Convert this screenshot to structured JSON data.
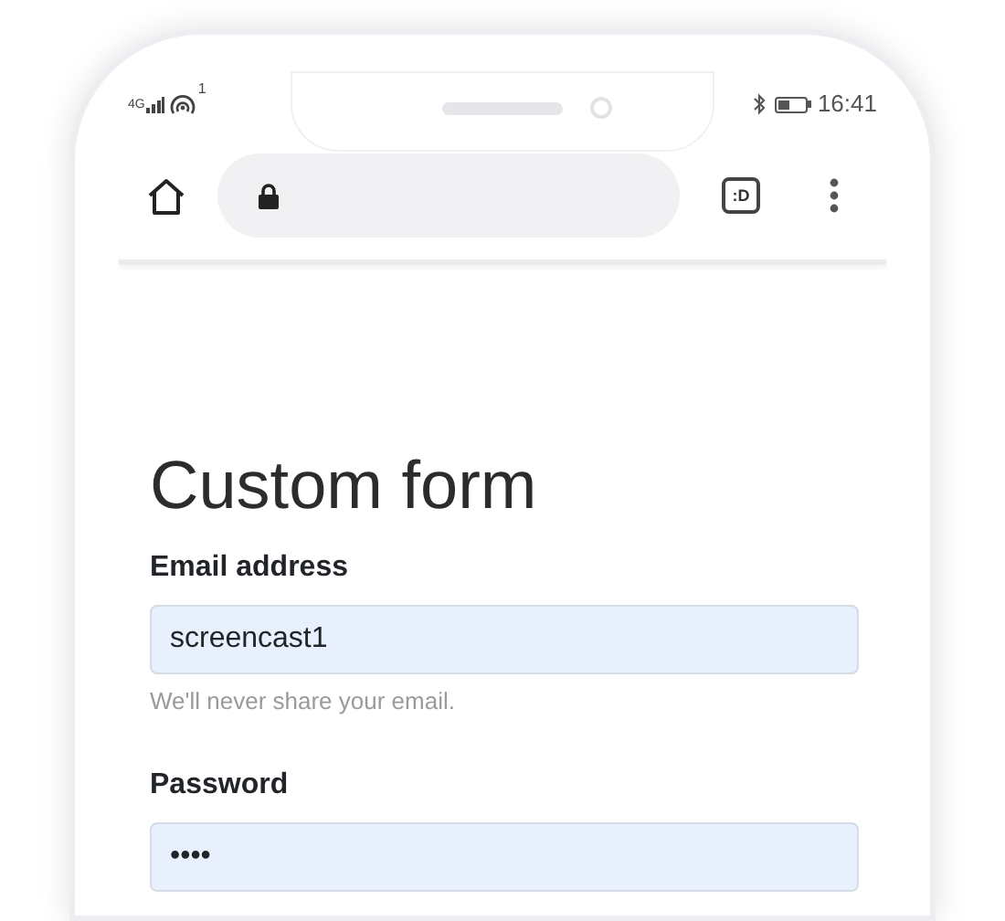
{
  "status_bar": {
    "network": "4G",
    "wifi_badge": "1",
    "time": "16:41"
  },
  "browser": {
    "tab_button": ":D"
  },
  "form": {
    "title": "Custom form",
    "fields": [
      {
        "label": "Email address",
        "value": "screencast1",
        "hint": "We'll never share your email."
      },
      {
        "label": "Password",
        "value": "••••"
      }
    ]
  }
}
